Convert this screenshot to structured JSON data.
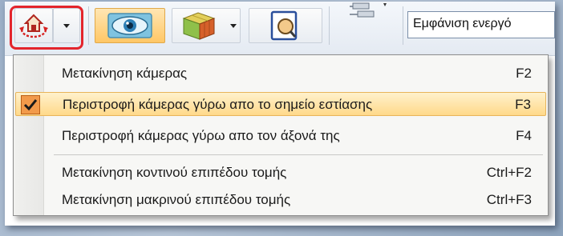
{
  "toolbar": {
    "view_combo_value": "Εμφάνιση ενεργό"
  },
  "menu": {
    "items": [
      {
        "label": "Μετακίνηση κάμερας",
        "shortcut": "F2",
        "checked": false,
        "selected": false
      },
      {
        "label": "Περιστροφή κάμερας γύρω απο το σημείο εστίασης",
        "shortcut": "F3",
        "checked": true,
        "selected": true
      },
      {
        "label": "Περιστροφή κάμερας γύρω απο τον άξονά της",
        "shortcut": "F4",
        "checked": false,
        "selected": false
      },
      {
        "label": "Μετακίνηση κοντινού επιπέδου τομής",
        "shortcut": "Ctrl+F2",
        "checked": false,
        "selected": false
      },
      {
        "label": "Μετακίνηση μακρινού επιπέδου τομής",
        "shortcut": "Ctrl+F3",
        "checked": false,
        "selected": false
      }
    ]
  },
  "colors": {
    "highlight_outline": "#e3252c",
    "selection": "#ffd98a",
    "check_box": "#f29a4a"
  }
}
